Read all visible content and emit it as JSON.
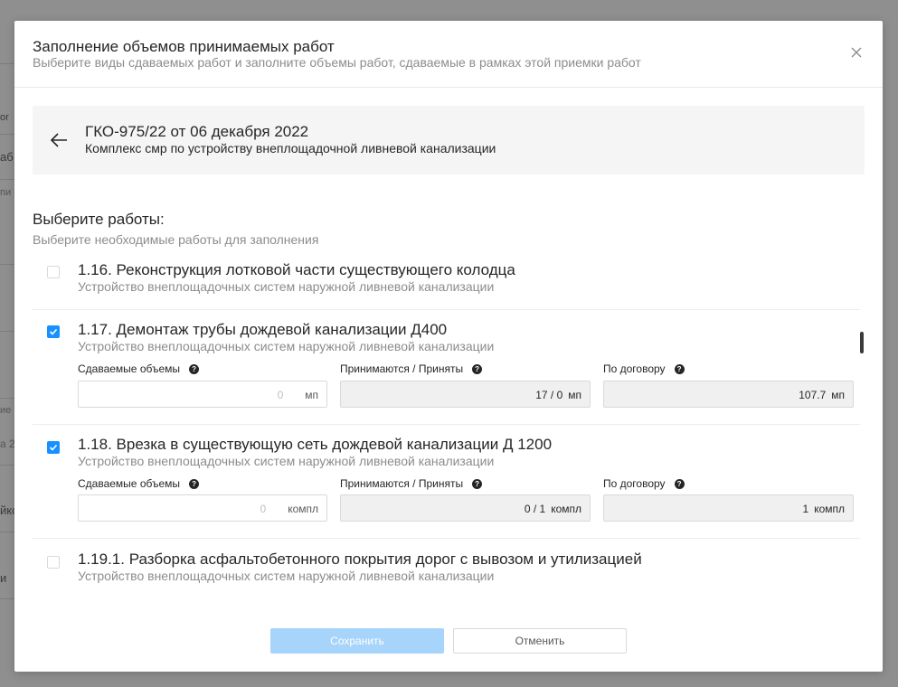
{
  "background": {
    "fragments": [
      "оr",
      "аб",
      "пи",
      "ие",
      "а 2",
      "йко",
      "и"
    ]
  },
  "modal": {
    "title": "Заполнение объемов принимаемых работ",
    "subtitle": "Выберите виды сдаваемых работ и заполните объемы работ, сдаваемые в рамках этой приемки работ",
    "close_icon": "close-icon"
  },
  "contract": {
    "title": "ГКО-975/22 от 06 декабря 2022",
    "subtitle": "Комплекс смр по устройству внеплощадочной ливневой канализации"
  },
  "section": {
    "title": "Выберите работы:",
    "subtitle": "Выберите необходимые работы для заполнения"
  },
  "labels": {
    "submitted": "Сдаваемые объемы",
    "accepted": "Принимаются / Приняты",
    "contract": "По договору",
    "help": "?"
  },
  "works": [
    {
      "title": "1.16. Реконструкция лотковой части существующего колодца",
      "subtitle": "Устройство внеплощадочных систем наружной ливневой канализации",
      "checked": false
    },
    {
      "title": "1.17. Демонтаж трубы дождевой канализации Д400",
      "subtitle": "Устройство внеплощадочных систем наружной ливневой канализации",
      "checked": true,
      "submitted_placeholder": "0",
      "unit": "мп",
      "accepted": "17 / 0",
      "contract": "107.7"
    },
    {
      "title": "1.18. Врезка в существующую сеть дождевой канализации Д 1200",
      "subtitle": "Устройство внеплощадочных систем наружной ливневой канализации",
      "checked": true,
      "submitted_placeholder": "0",
      "unit": "компл",
      "accepted": "0 / 1",
      "contract": "1"
    },
    {
      "title": "1.19.1. Разборка асфальтобетонного покрытия дорог с вывозом и утилизацией",
      "subtitle": "Устройство внеплощадочных систем наружной ливневой канализации",
      "checked": false
    }
  ],
  "footer": {
    "save_label": "Сохранить",
    "cancel_label": "Отменить"
  },
  "colors": {
    "primary": "#1890ff",
    "primary_disabled": "#a6d4fa"
  }
}
